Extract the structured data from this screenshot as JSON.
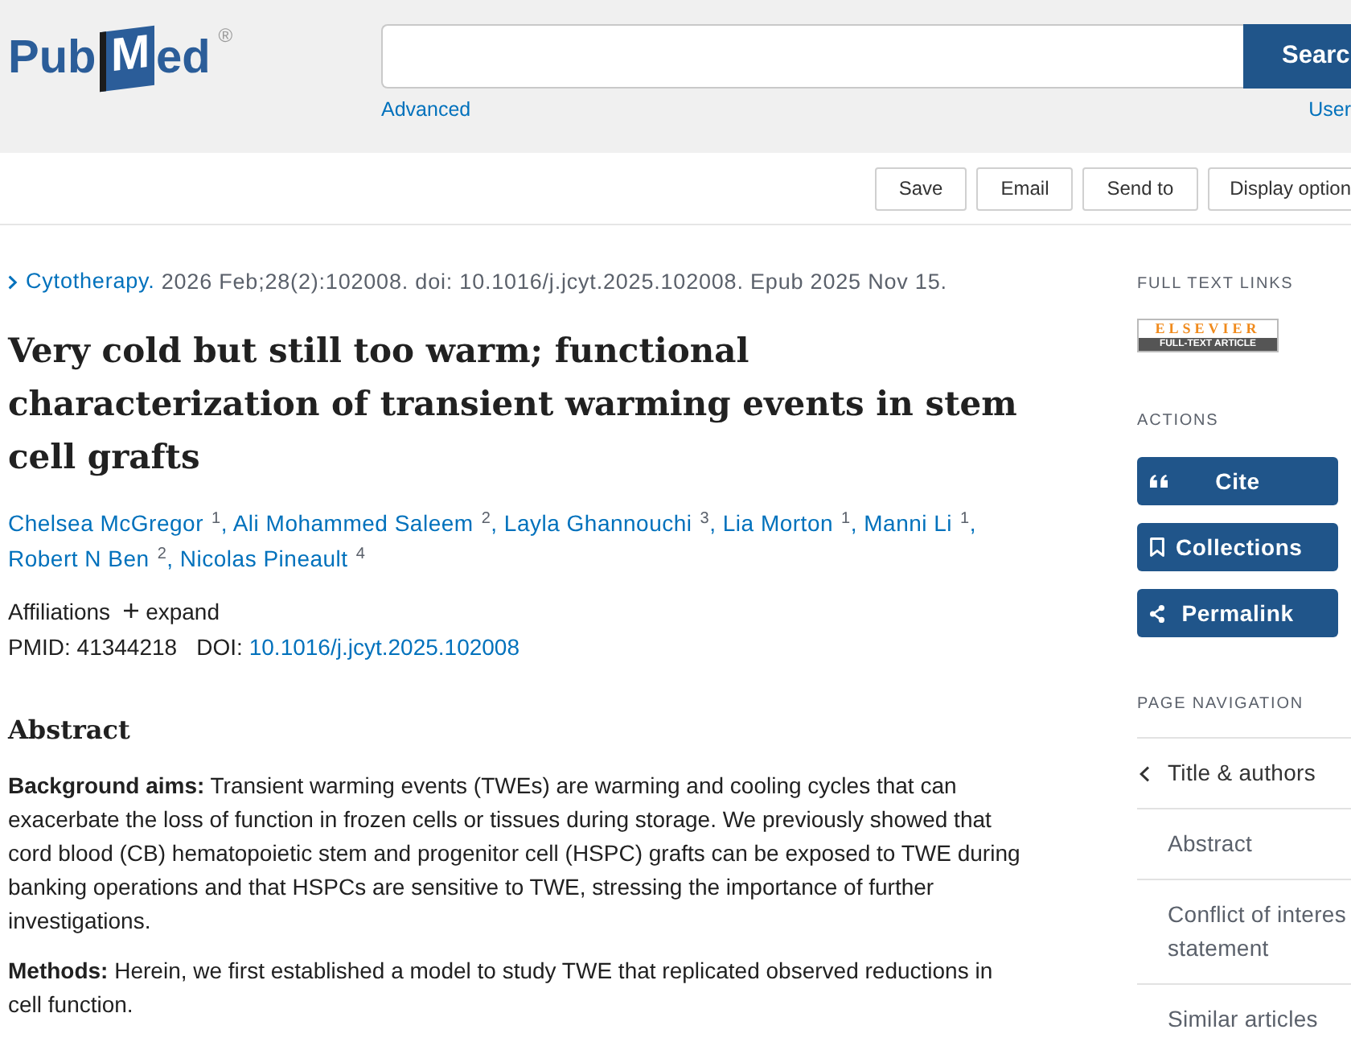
{
  "header": {
    "logo": {
      "prefix": "Pub",
      "initial": "M",
      "suffix": "ed",
      "mark": "®"
    },
    "search": {
      "button": "Searc"
    },
    "links": {
      "advanced": "Advanced",
      "user": "User"
    }
  },
  "toolbar": [
    "Save",
    "Email",
    "Send to",
    "Display option"
  ],
  "citation": {
    "journal": "Cytotherapy.",
    "details": "2026 Feb;28(2):102008. doi: 10.1016/j.jcyt.2025.102008. Epub 2025 Nov 15."
  },
  "title": "Very cold but still too warm; functional characterization of transient warming events in stem cell grafts",
  "authors": [
    {
      "name": "Chelsea McGregor",
      "affiliation": "1",
      "trailing": ","
    },
    {
      "name": "Ali Mohammed Saleem",
      "affiliation": "2",
      "trailing": ","
    },
    {
      "name": "Layla Ghannouchi",
      "affiliation": "3",
      "trailing": ","
    },
    {
      "name": "Lia Morton",
      "affiliation": "1",
      "trailing": ","
    },
    {
      "name": "Manni Li",
      "affiliation": "1",
      "trailing": ","
    },
    {
      "name": "Robert N Ben",
      "affiliation": "2",
      "trailing": ","
    },
    {
      "name": "Nicolas Pineault",
      "affiliation": "4"
    }
  ],
  "affiliations": {
    "label": "Affiliations",
    "toggle": "expand"
  },
  "identifiers": {
    "pmid": "PMID: 41344218",
    "doi_label": "DOI:",
    "doi": "10.1016/j.jcyt.2025.102008"
  },
  "abstract": {
    "heading": "Abstract",
    "paragraphs": [
      "**Background aims:** Transient warming events (TWEs) are warming and cooling cycles that can exacerbate the loss of function in frozen cells or tissues during storage. We previously showed that cord blood (CB) hematopoietic stem and progenitor cell (HSPC) grafts can be exposed to TWE during banking operations and that HSPCs are sensitive to TWE, stressing the importance of further investigations.",
      "**Methods:** Herein, we first established a model to study TWE that replicated observed reductions in cell function."
    ]
  },
  "sidebar": {
    "full_text_links": {
      "heading": "FULL TEXT LINKS",
      "publisher": {
        "name": "ELSEVIER",
        "caption": "FULL-TEXT ARTICLE"
      }
    },
    "actions": {
      "heading": "ACTIONS",
      "buttons": [
        {
          "kind": "cite",
          "label": "Cite"
        },
        {
          "kind": "collections",
          "label": "Collections"
        },
        {
          "kind": "permalink",
          "label": "Permalink"
        }
      ]
    },
    "page_navigation": {
      "heading": "PAGE NAVIGATION",
      "items": [
        {
          "label": "Title & authors",
          "selected": true
        },
        {
          "label": "Abstract",
          "selected": false
        },
        {
          "label": "Conflict of interes statement",
          "selected": false
        },
        {
          "label": "Similar articles",
          "selected": false
        }
      ]
    }
  }
}
